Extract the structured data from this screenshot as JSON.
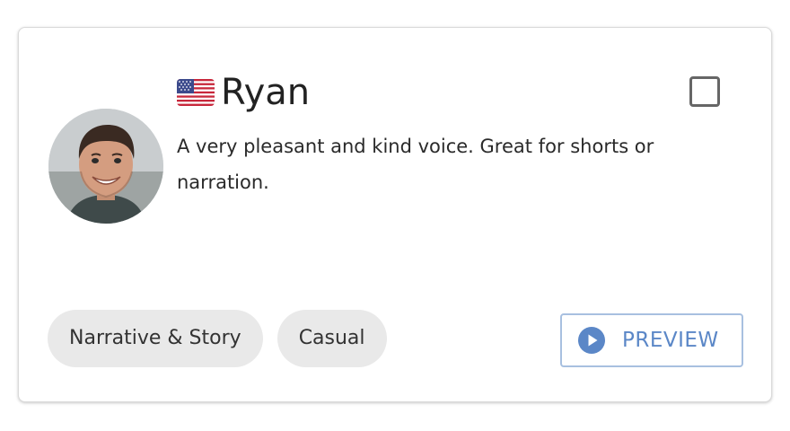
{
  "voice": {
    "flag_icon": "us-flag-icon",
    "name": "Ryan",
    "description": "A very pleasant and kind voice. Great for shorts or narration.",
    "selected": false
  },
  "tags": [
    "Narrative & Story",
    "Casual"
  ],
  "preview": {
    "label": "PREVIEW",
    "icon": "play-circle-icon"
  },
  "colors": {
    "accent": "#5b87c7",
    "tag_background": "#e9e9e9",
    "checkbox_border": "#666666"
  }
}
